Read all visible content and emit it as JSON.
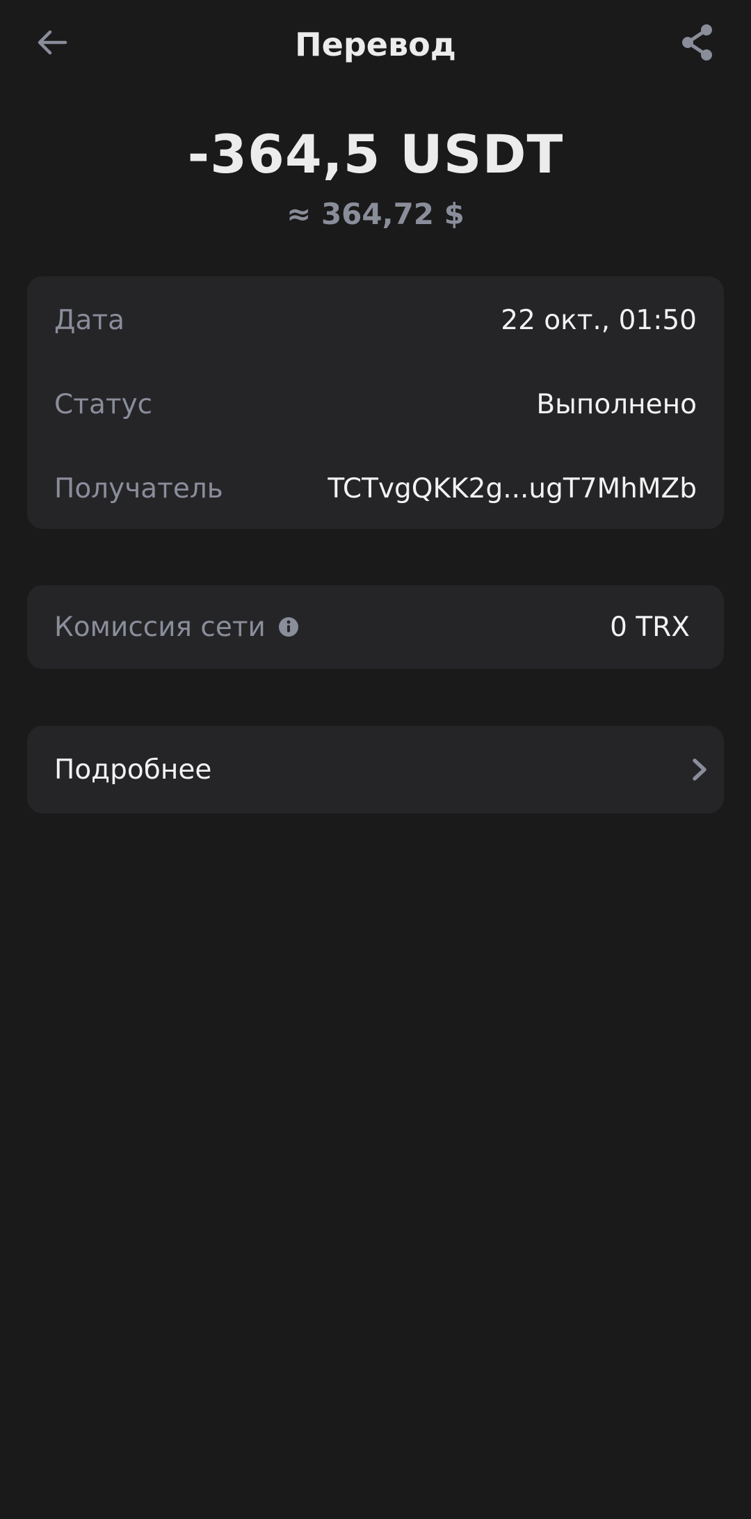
{
  "header": {
    "title": "Перевод"
  },
  "amount": {
    "value": "-364,5 USDT",
    "fiat": "≈ 364,72 $"
  },
  "details": {
    "rows": [
      {
        "label": "Дата",
        "value": "22 окт., 01:50"
      },
      {
        "label": "Статус",
        "value": "Выполнено"
      },
      {
        "label": "Получатель",
        "value": "TCTvgQKK2g...ugT7MhMZb"
      }
    ]
  },
  "fee": {
    "label": "Комиссия сети",
    "value": "0 TRX"
  },
  "more": {
    "label": "Подробнее"
  },
  "colors": {
    "background": "#1a1a1a",
    "card": "#252528",
    "muted_text": "#8a8d9a",
    "primary_text": "#ececec"
  }
}
